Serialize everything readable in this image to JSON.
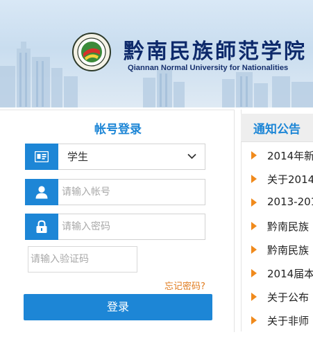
{
  "header": {
    "school_name_cn": "黔南民族師范学院",
    "school_name_en": "Qiannan Normal University for Nationalities"
  },
  "login": {
    "title": "帐号登录",
    "role_select": {
      "selected": "学生"
    },
    "username": {
      "placeholder": "请输入帐号"
    },
    "password": {
      "placeholder": "请输入密码"
    },
    "captcha": {
      "placeholder": "请输入验证码"
    },
    "forgot_label": "忘记密码?",
    "submit_label": "登录"
  },
  "notices": {
    "title": "通知公告",
    "items": [
      {
        "text": "2014年新"
      },
      {
        "text": "关于2014"
      },
      {
        "text": "2013-201"
      },
      {
        "text": "黔南民族"
      },
      {
        "text": "黔南民族"
      },
      {
        "text": "2014届本"
      },
      {
        "text": "关于公布"
      },
      {
        "text": "关于非师"
      }
    ]
  },
  "colors": {
    "accent": "#1d86d6",
    "link_orange": "#e07b1e",
    "bullet_orange": "#f08a1c",
    "school_navy": "#0e2a6b"
  },
  "icons": {
    "role": "id-card-icon",
    "username": "user-icon",
    "password": "lock-icon",
    "dropdown": "chevron-down-icon",
    "bullet": "triangle-right-icon"
  }
}
